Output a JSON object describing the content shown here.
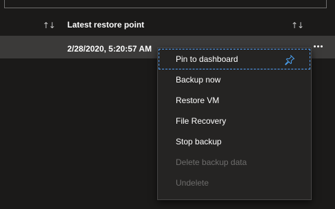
{
  "table": {
    "sort_icon_glyph": "↑↓",
    "columns": [
      {
        "label": "Latest restore point"
      }
    ],
    "rows": [
      {
        "latest_restore_point": "2/28/2020, 5:20:57 AM"
      }
    ]
  },
  "context_menu": {
    "items": [
      {
        "label": "Pin to dashboard",
        "enabled": true,
        "focused": true,
        "icon": "pin-icon"
      },
      {
        "label": "Backup now",
        "enabled": true
      },
      {
        "label": "Restore VM",
        "enabled": true
      },
      {
        "label": "File Recovery",
        "enabled": true
      },
      {
        "label": "Stop backup",
        "enabled": true
      },
      {
        "label": "Delete backup data",
        "enabled": false
      },
      {
        "label": "Undelete",
        "enabled": false
      }
    ]
  },
  "colors": {
    "background": "#1b1a19",
    "selected_row": "#3b3a39",
    "menu_background": "#252423",
    "focus_outline": "#55a4ff",
    "disabled_text": "#6e6d6c"
  }
}
